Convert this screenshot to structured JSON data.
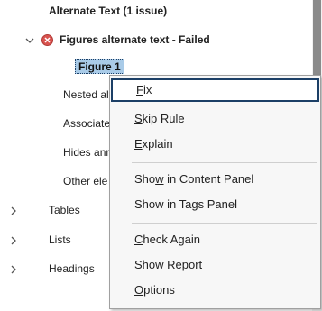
{
  "tree": {
    "alt_text_group": "Alternate Text (1 issue)",
    "figures_rule": "Figures alternate text - Failed",
    "figure_item": "Figure 1",
    "nested": "Nested alt",
    "associated": "Associate",
    "hides": "Hides ann",
    "other": "Other ele",
    "tables": "Tables",
    "lists": "Lists",
    "headings": "Headings"
  },
  "menu": {
    "fix": {
      "pre": "",
      "u": "F",
      "post": "ix"
    },
    "skip": {
      "pre": "",
      "u": "S",
      "post": "kip Rule"
    },
    "explain": {
      "pre": "",
      "u": "E",
      "post": "xplain"
    },
    "show_content": {
      "pre": "Sho",
      "u": "w",
      "post": " in Content Panel"
    },
    "show_tags": {
      "pre": "Show in Ta",
      "u": "g",
      "post": "s Panel"
    },
    "check_again": {
      "pre": "",
      "u": "C",
      "post": "heck Again"
    },
    "show_report": {
      "pre": "Show ",
      "u": "R",
      "post": "eport"
    },
    "options": {
      "pre": "",
      "u": "O",
      "post": "ptions"
    }
  },
  "colors": {
    "error": "#d9534f",
    "selection": "#a9cbe8",
    "highlight_border": "#1c3f66"
  }
}
